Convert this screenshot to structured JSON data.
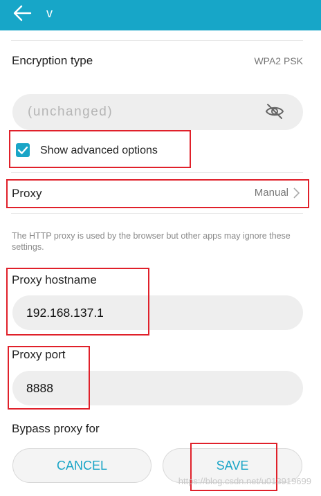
{
  "header": {
    "title": "v",
    "background_color": "#17a6c8"
  },
  "encryption": {
    "label": "Encryption type",
    "value": "WPA2 PSK"
  },
  "password": {
    "placeholder": "(unchanged)",
    "toggle_icon": "eye-off-icon"
  },
  "advanced": {
    "checkbox_label": "Show advanced options",
    "checked": true
  },
  "proxy": {
    "label": "Proxy",
    "value": "Manual",
    "hint": "The HTTP proxy is used by the browser but other apps may ignore these settings."
  },
  "hostname": {
    "label": "Proxy hostname",
    "value": "192.168.137.1"
  },
  "port": {
    "label": "Proxy port",
    "value": "8888"
  },
  "bypass": {
    "label": "Bypass proxy for"
  },
  "buttons": {
    "cancel": "CANCEL",
    "save": "SAVE"
  },
  "watermark": "https://blog.csdn.net/u013919699",
  "colors": {
    "accent": "#1aa5c7",
    "highlight_box": "#e0202a"
  }
}
